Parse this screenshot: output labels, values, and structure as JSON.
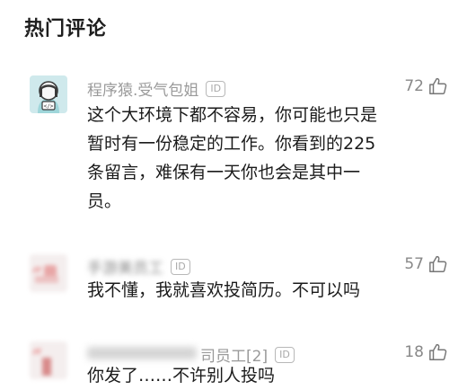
{
  "section": {
    "title": "热门评论"
  },
  "comments": [
    {
      "username": "程序猿.受气包姐",
      "id_badge": "ID",
      "likes": "72",
      "text": "这个大环境下都不容易，你可能也只是暂时有一份稳定的工作。你看到的225条留言，难保有一天你也会是其中一员。",
      "avatar_icon": "programmer-girl-avatar-icon"
    },
    {
      "username": "手游美员工",
      "id_badge": "ID",
      "likes": "57",
      "text": "我不懂，我就喜欢投简历。不可以吗",
      "avatar_icon": "blurred-avatar-icon"
    },
    {
      "username": "司员工[2]",
      "id_badge": "ID",
      "likes": "18",
      "text": "你发了……不许别人投吗",
      "avatar_icon": "blurred-avatar-icon"
    }
  ],
  "colors": {
    "avatar_bg": "#cfe9ec",
    "blur_pink": "#e88a8a"
  }
}
